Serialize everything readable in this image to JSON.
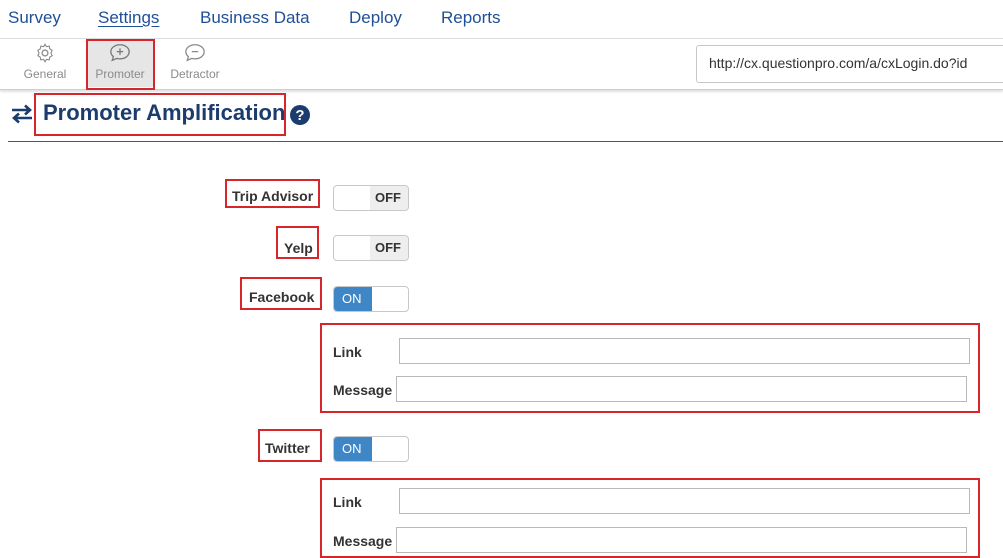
{
  "topnav": {
    "tabs": [
      {
        "label": "Survey"
      },
      {
        "label": "Settings"
      },
      {
        "label": "Business Data"
      },
      {
        "label": "Deploy"
      },
      {
        "label": "Reports"
      }
    ]
  },
  "subnav": {
    "items": [
      {
        "label": "General",
        "icon": "gear-icon"
      },
      {
        "label": "Promoter",
        "icon": "chat-plus-icon",
        "selected": true
      },
      {
        "label": "Detractor",
        "icon": "chat-minus-icon"
      }
    ],
    "url": "http://cx.questionpro.com/a/cxLogin.do?id"
  },
  "page": {
    "title": "Promoter Amplification",
    "help_icon": "question-circle-icon",
    "title_icon": "swap-arrows-icon"
  },
  "platforms": {
    "trip_advisor": {
      "label": "Trip Advisor",
      "state": "OFF"
    },
    "yelp": {
      "label": "Yelp",
      "state": "OFF"
    },
    "facebook": {
      "label": "Facebook",
      "state": "ON",
      "link_label": "Link",
      "message_label": "Message",
      "link_value": "",
      "message_value": ""
    },
    "twitter": {
      "label": "Twitter",
      "state": "ON",
      "link_label": "Link",
      "message_label": "Message",
      "link_value": "",
      "message_value": ""
    }
  },
  "colors": {
    "nav_text": "#1f4f96",
    "title_text": "#1c3c6e",
    "toggle_on": "#3f86c6",
    "highlight_border": "#d6262b"
  }
}
